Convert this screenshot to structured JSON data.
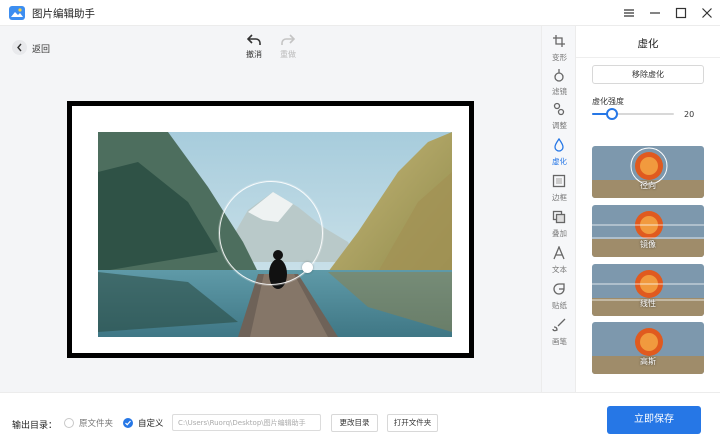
{
  "app": {
    "title": "图片编辑助手"
  },
  "toolbar": {
    "back_label": "返回",
    "undo_label": "撤消",
    "redo_label": "重做"
  },
  "tools": [
    {
      "label": "变形",
      "icon": "crop-icon",
      "active": false
    },
    {
      "label": "滤镜",
      "icon": "filter-icon",
      "active": false
    },
    {
      "label": "调整",
      "icon": "adjust-icon",
      "active": false
    },
    {
      "label": "虚化",
      "icon": "drop-icon",
      "active": true
    },
    {
      "label": "边框",
      "icon": "border-icon",
      "active": false
    },
    {
      "label": "叠加",
      "icon": "overlay-icon",
      "active": false
    },
    {
      "label": "文本",
      "icon": "text-icon",
      "active": false
    },
    {
      "label": "贴纸",
      "icon": "sticker-icon",
      "active": false
    },
    {
      "label": "画笔",
      "icon": "brush-icon",
      "active": false
    }
  ],
  "panel": {
    "title": "虚化",
    "remove_label": "移除虚化",
    "intensity_label": "虚化强度",
    "intensity_value": "20",
    "intensity_fraction": 0.24,
    "presets": [
      {
        "label": "径向"
      },
      {
        "label": "镜像"
      },
      {
        "label": "线性"
      },
      {
        "label": "高斯"
      }
    ]
  },
  "footer": {
    "output_label": "输出目录：",
    "option_original": "原文件夹",
    "option_custom": "自定义",
    "path_value": "C:\\Users\\Ruorq\\Desktop\\图片编辑助手",
    "change_dir_label": "更改目录",
    "open_folder_label": "打开文件夹",
    "save_label": "立即保存"
  },
  "colors": {
    "accent": "#2677e6",
    "frame": "#000000"
  }
}
